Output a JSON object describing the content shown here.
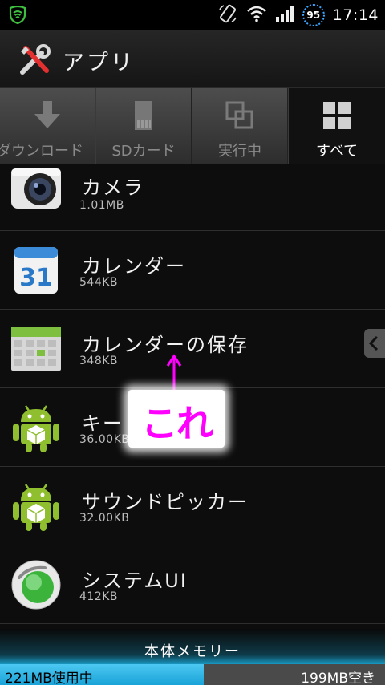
{
  "status_bar": {
    "battery": "95",
    "time": "17:14",
    "icons": [
      "android-debug-icon",
      "rotate-icon",
      "wifi-icon",
      "signal-icon",
      "battery-icon"
    ]
  },
  "title_bar": {
    "icon": "tools-icon",
    "title": "アプリ"
  },
  "tabs": [
    {
      "label": "ダウンロード",
      "icon": "download-icon",
      "active": false
    },
    {
      "label": "SDカード",
      "icon": "sdcard-icon",
      "active": false
    },
    {
      "label": "実行中",
      "icon": "running-icon",
      "active": false
    },
    {
      "label": "すべて",
      "icon": "grid-icon",
      "active": true
    }
  ],
  "apps": [
    {
      "name": "カメラ",
      "size": "1.01MB",
      "icon": "camera-icon"
    },
    {
      "name": "カレンダー",
      "size": "544KB",
      "icon": "calendar-icon"
    },
    {
      "name": "カレンダーの保存",
      "size": "348KB",
      "icon": "calendar-storage-icon"
    },
    {
      "name": "キー",
      "size": "36.00KB",
      "icon": "android-icon"
    },
    {
      "name": "サウンドピッカー",
      "size": "32.00KB",
      "icon": "android-icon"
    },
    {
      "name": "システムUI",
      "size": "412KB",
      "icon": "sony-ericsson-icon"
    }
  ],
  "annotation": {
    "text": "これ"
  },
  "storage": {
    "title": "本体メモリー",
    "used": "221MB使用中",
    "free": "199MB空き",
    "used_fraction": 0.53
  },
  "colors": {
    "accent_blue": "#1aa3d8",
    "annotation_magenta": "#ff00ff"
  }
}
